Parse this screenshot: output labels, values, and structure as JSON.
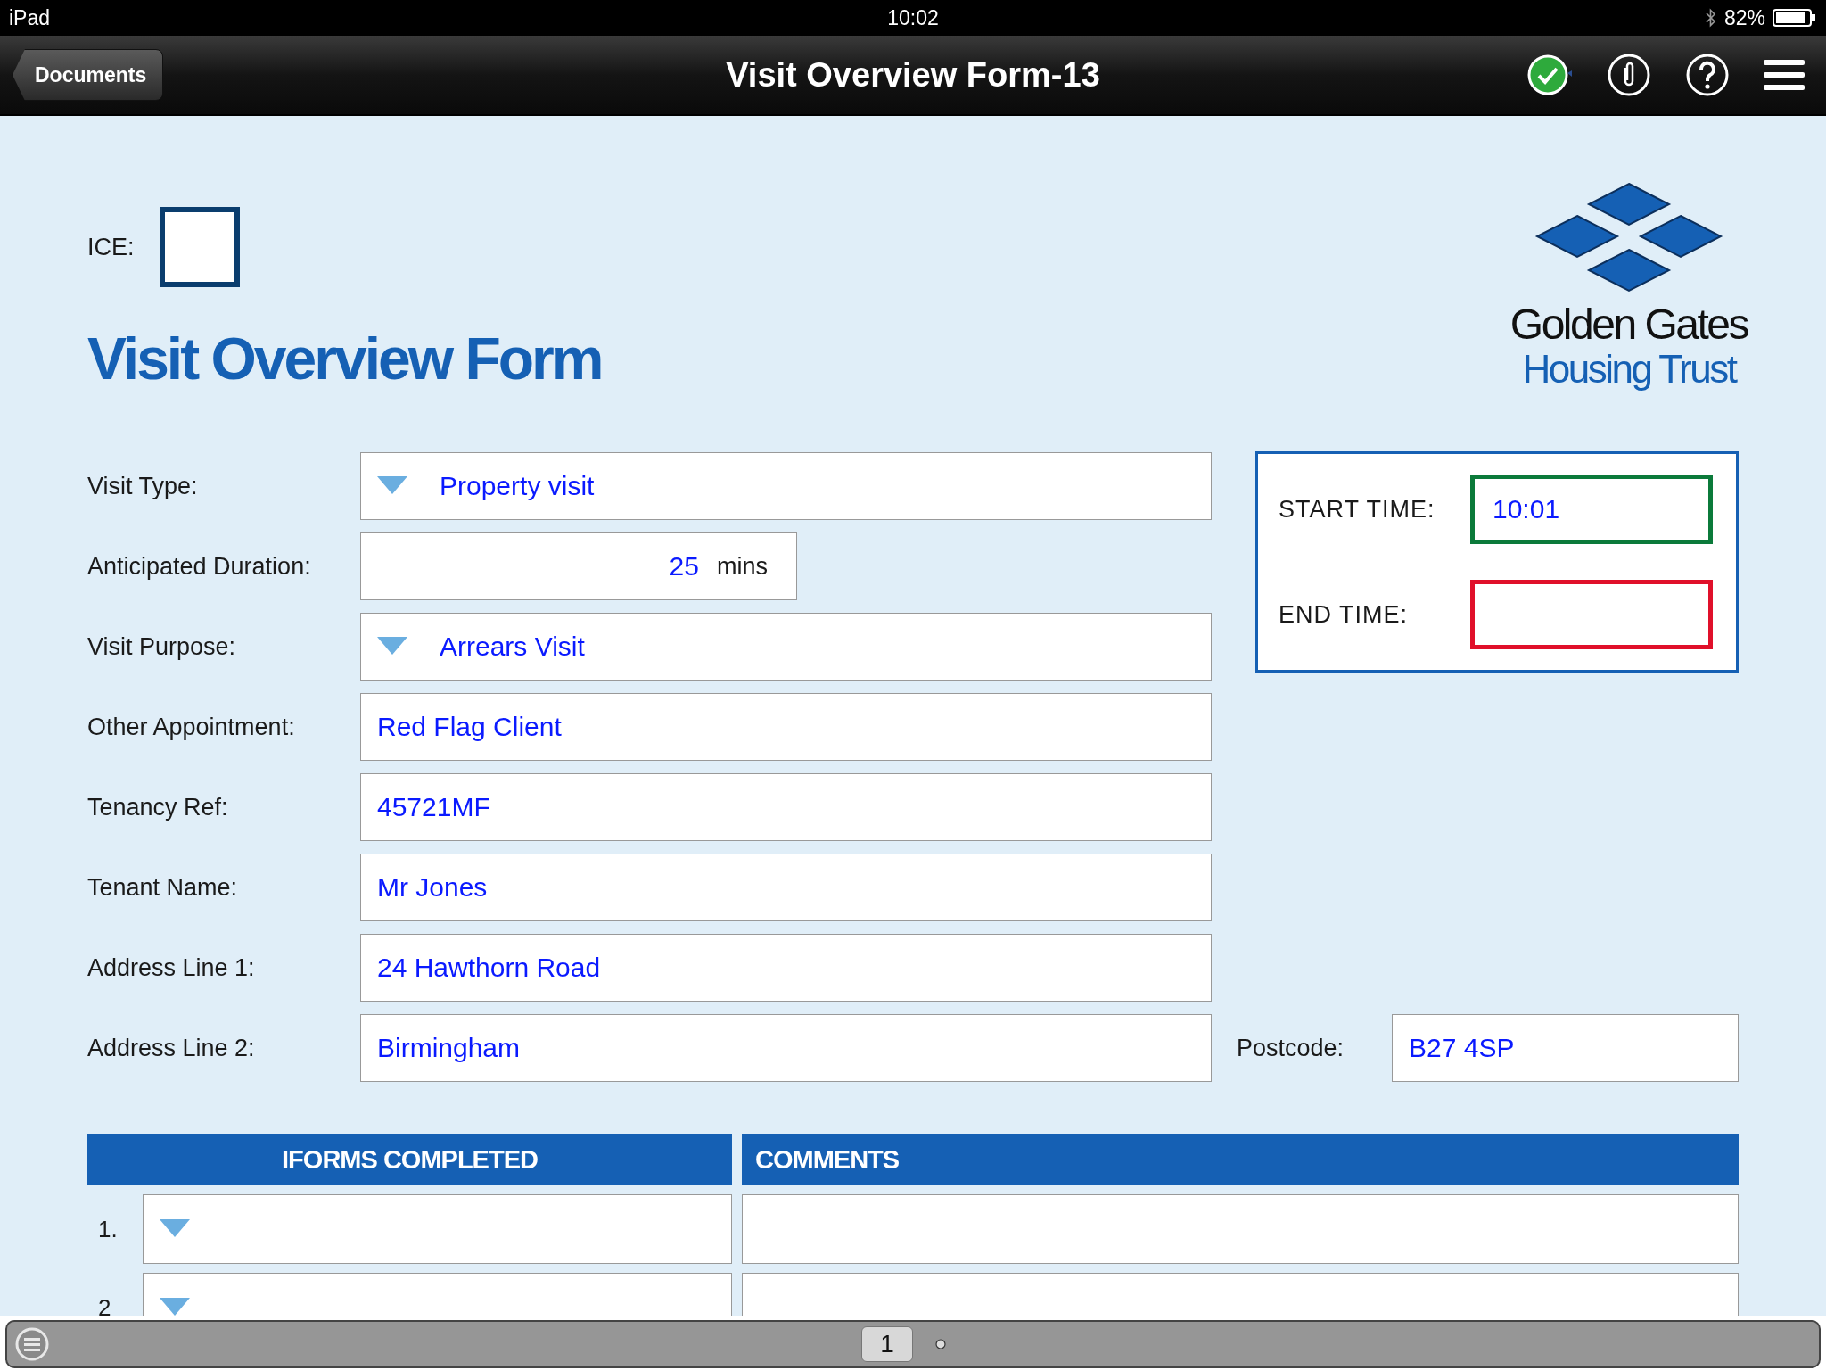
{
  "status_bar": {
    "device": "iPad",
    "time": "10:02",
    "battery": "82%"
  },
  "nav": {
    "back": "Documents",
    "title": "Visit Overview Form-13"
  },
  "ice": {
    "label": "ICE:",
    "checked": false
  },
  "form_title": "Visit Overview Form",
  "logo": {
    "line1": "Golden Gates",
    "line2": "Housing Trust"
  },
  "fields": [
    {
      "label": "Visit Type:",
      "kind": "dropdown",
      "value": "Property visit"
    },
    {
      "label": "Anticipated Duration:",
      "kind": "duration",
      "value": "25",
      "unit": "mins"
    },
    {
      "label": "Visit Purpose:",
      "kind": "dropdown",
      "value": "Arrears Visit"
    },
    {
      "label": "Other Appointment:",
      "kind": "text",
      "value": "Red Flag Client"
    },
    {
      "label": "Tenancy Ref:",
      "kind": "text",
      "value": "45721MF"
    },
    {
      "label": "Tenant Name:",
      "kind": "text",
      "value": "Mr Jones"
    },
    {
      "label": "Address Line 1:",
      "kind": "text",
      "value": "24 Hawthorn Road"
    },
    {
      "label": "Address Line 2:",
      "kind": "text",
      "value": "Birmingham"
    }
  ],
  "times": [
    {
      "label": "START TIME:",
      "value": "10:01",
      "color": "#0b7a3a"
    },
    {
      "label": "END TIME:",
      "color": "#e0102a"
    }
  ],
  "postcode": {
    "label": "Postcode:",
    "value": "B27 4SP"
  },
  "table": {
    "columns": [
      "IFORMS COMPLETED",
      "COMMENTS"
    ],
    "rows": [
      {
        "number": "1."
      },
      {
        "number": "2"
      }
    ]
  },
  "toolbar": {
    "page": "1"
  }
}
